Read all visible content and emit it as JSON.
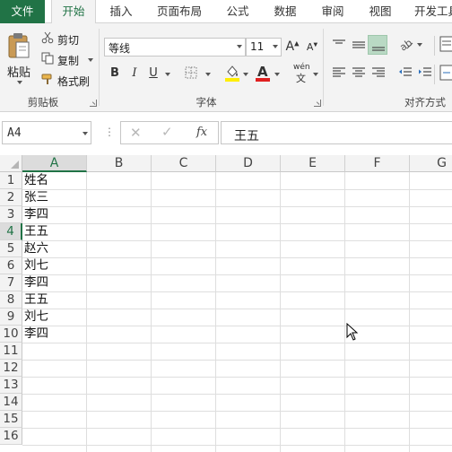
{
  "ribbon_tabs": [
    "文件",
    "开始",
    "插入",
    "页面布局",
    "公式",
    "数据",
    "审阅",
    "视图",
    "开发工具"
  ],
  "active_tab": "开始",
  "clipboard": {
    "paste_label": "粘贴",
    "cut_label": "剪切",
    "copy_label": "复制",
    "format_painter_label": "格式刷",
    "group_label": "剪贴板"
  },
  "font": {
    "font_name": "等线",
    "font_size": "11",
    "bold": "B",
    "italic": "I",
    "underline": "U",
    "grow_icon_text": "A",
    "shrink_icon_text": "A",
    "font_color_icon_text": "A",
    "phonetic_label": "wén",
    "phonetic_sub": "文",
    "group_label": "字体"
  },
  "alignment": {
    "group_label": "对齐方式"
  },
  "formula_bar": {
    "name_box": "A4",
    "fx_label": "fx",
    "cancel_icon": "✕",
    "enter_icon": "✓",
    "content": "王五"
  },
  "sheet": {
    "columns": [
      "A",
      "B",
      "C",
      "D",
      "E",
      "F",
      "G"
    ],
    "rows": [
      "1",
      "2",
      "3",
      "4",
      "5",
      "6",
      "7",
      "8",
      "9",
      "10",
      "11",
      "12",
      "13",
      "14",
      "15",
      "16"
    ],
    "selected_cell": "A4",
    "column_a_values": [
      "姓名",
      "张三",
      "李四",
      "王五",
      "赵六",
      "刘七",
      "李四",
      "王五",
      "刘七",
      "李四"
    ]
  },
  "colors": {
    "excel_green": "#217346",
    "ribbon_bg": "#f3f3f3",
    "font_color_bar": "#e02020",
    "fill_color_bar": "#ffee00"
  }
}
